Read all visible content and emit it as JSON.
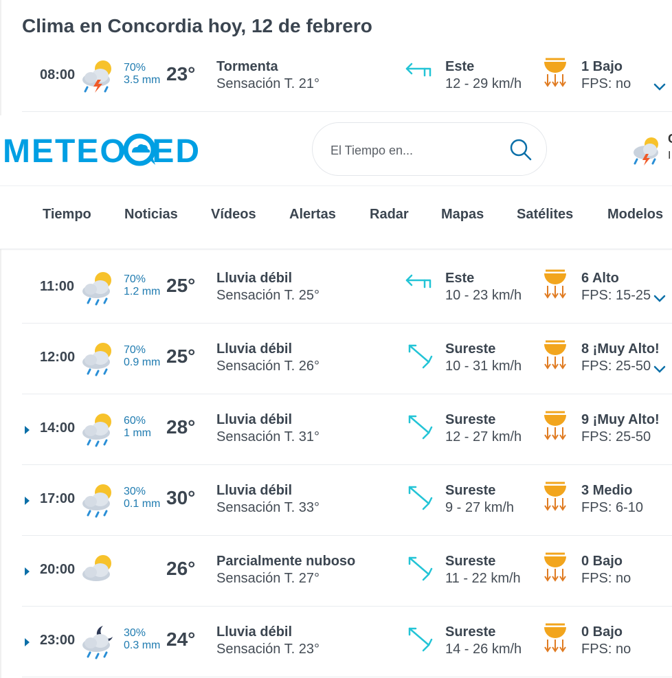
{
  "page": {
    "title": "Clima en Concordia hoy, 12 de febrero"
  },
  "header": {
    "logo_text": "METEORED",
    "search_placeholder": "El Tiempo en...",
    "location_initial": "C",
    "location_sub": "I"
  },
  "nav": [
    "Tiempo",
    "Noticias",
    "Vídeos",
    "Alertas",
    "Radar",
    "Mapas",
    "Satélites",
    "Modelos"
  ],
  "colors": {
    "brand": "#009fe3",
    "text": "#3b4550",
    "rain": "#1f7bb0",
    "wind_arrow": "#23c4d6"
  },
  "rows": [
    {
      "time": "08:00",
      "icon": "storm-icon",
      "prob": "70%",
      "mm": "3.5 mm",
      "temp": "23°",
      "cond": "Tormenta",
      "feel": "Sensación T. 21°",
      "wdir": "Este",
      "wspd": "12 - 29 km/h",
      "wind_icon": "wind-arrow-west-icon",
      "uv": "1 Bajo",
      "fps": "FPS: no",
      "expander": false,
      "chevron": true
    },
    {
      "time": "11:00",
      "icon": "light-rain-icon",
      "prob": "70%",
      "mm": "1.2 mm",
      "temp": "25°",
      "cond": "Lluvia débil",
      "feel": "Sensación T. 25°",
      "wdir": "Este",
      "wspd": "10 - 23 km/h",
      "wind_icon": "wind-arrow-west-icon",
      "uv": "6 Alto",
      "fps": "FPS: 15-25",
      "expander": false,
      "chevron": true
    },
    {
      "time": "12:00",
      "icon": "light-rain-icon",
      "prob": "70%",
      "mm": "0.9 mm",
      "temp": "25°",
      "cond": "Lluvia débil",
      "feel": "Sensación T. 26°",
      "wdir": "Sureste",
      "wspd": "10 - 31 km/h",
      "wind_icon": "wind-arrow-northwest-icon",
      "uv": "8 ¡Muy Alto!",
      "fps": "FPS: 25-50",
      "expander": false,
      "chevron": true
    },
    {
      "time": "14:00",
      "icon": "light-rain-icon",
      "prob": "60%",
      "mm": "1 mm",
      "temp": "28°",
      "cond": "Lluvia débil",
      "feel": "Sensación T. 31°",
      "wdir": "Sureste",
      "wspd": "12 - 27 km/h",
      "wind_icon": "wind-arrow-northwest-icon",
      "uv": "9 ¡Muy Alto!",
      "fps": "FPS: 25-50",
      "expander": true,
      "chevron": false
    },
    {
      "time": "17:00",
      "icon": "light-rain-icon",
      "prob": "30%",
      "mm": "0.1 mm",
      "temp": "30°",
      "cond": "Lluvia débil",
      "feel": "Sensación T. 33°",
      "wdir": "Sureste",
      "wspd": "9 - 27 km/h",
      "wind_icon": "wind-arrow-northwest-icon",
      "uv": "3 Medio",
      "fps": "FPS: 6-10",
      "expander": true,
      "chevron": false
    },
    {
      "time": "20:00",
      "icon": "partly-cloudy-icon",
      "prob": "",
      "mm": "",
      "temp": "26°",
      "cond": "Parcialmente nuboso",
      "feel": "Sensación T. 27°",
      "wdir": "Sureste",
      "wspd": "11 - 22 km/h",
      "wind_icon": "wind-arrow-northwest-icon",
      "uv": "0 Bajo",
      "fps": "FPS: no",
      "expander": true,
      "chevron": false
    },
    {
      "time": "23:00",
      "icon": "night-rain-icon",
      "prob": "30%",
      "mm": "0.3 mm",
      "temp": "24°",
      "cond": "Lluvia débil",
      "feel": "Sensación T. 23°",
      "wdir": "Sureste",
      "wspd": "14 - 26 km/h",
      "wind_icon": "wind-arrow-northwest-icon",
      "uv": "0 Bajo",
      "fps": "FPS: no",
      "expander": true,
      "chevron": false
    }
  ]
}
